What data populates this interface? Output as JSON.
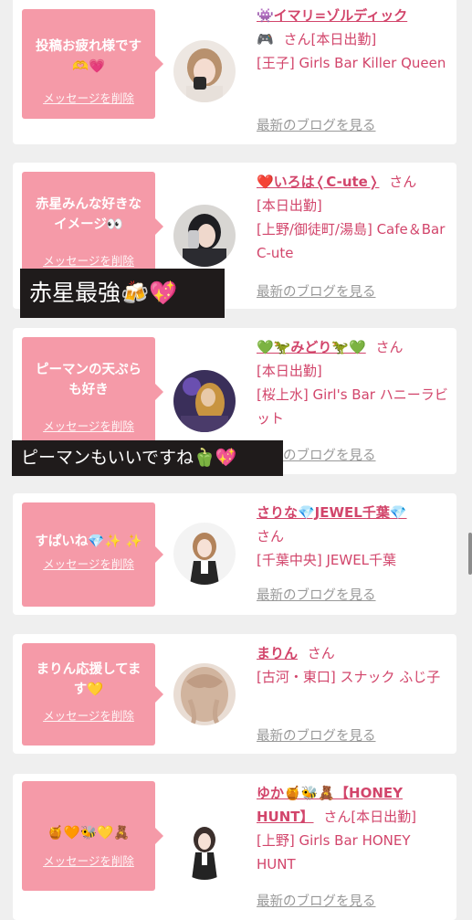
{
  "common": {
    "delete_label": "メッセージを削除",
    "blog_label": "最新のブログを見る",
    "san": "さん"
  },
  "cards": [
    {
      "message": "投稿お疲れ様です\n🫶💗",
      "name": "👾イマリ=ゾルディック",
      "name_suffix": "🎮",
      "status": "[本日出勤]",
      "shop": "[王子] Girls Bar Killer Queen"
    },
    {
      "message": "赤星みんな好きな\nイメージ👀",
      "name": "❤️いろは❬C-ute❭",
      "status": "[本日出勤]",
      "shop": "[上野/御徒町/湯島] Cafe＆Bar C-ute"
    },
    {
      "message": "ピーマンの天ぷら\nも好き",
      "name": "💚🦖みどり🦖💚",
      "status": "[本日出勤]",
      "shop": "[桜上水] Girl's Bar ハニーラビット"
    },
    {
      "message": "すぱいね💎✨ ✨",
      "name": "さりな💎JEWEL千葉💎",
      "status": "",
      "shop": "[千葉中央] JEWEL千葉"
    },
    {
      "message": "まりん応援してま\nす💛",
      "name": "まりん",
      "status": "",
      "shop": "[古河・東口] スナック ふじ子"
    },
    {
      "message": "🍯🧡🐝💛🧸",
      "name": "ゆか🍯🐝🧸【HONEY HUNT】",
      "status": "[本日出勤]",
      "shop": "[上野] Girls Bar HONEY HUNT"
    }
  ],
  "overlays": {
    "first": "赤星最強🍻💖",
    "second": "ピーマンもいいですね🫑💖"
  },
  "colors": {
    "accent": "#d2456b",
    "bubble": "#f59aa8",
    "overlay_bg": "#1f1b1b"
  }
}
